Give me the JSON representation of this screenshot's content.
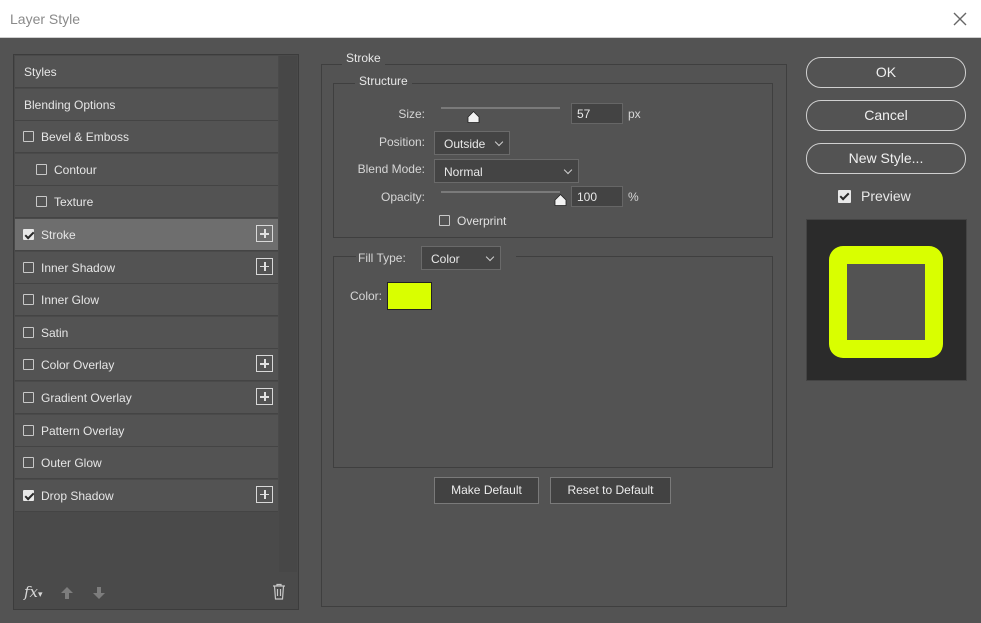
{
  "window": {
    "title": "Layer Style",
    "close_icon": "close-icon"
  },
  "styles_list": {
    "items": [
      {
        "label": "Styles",
        "checkbox": false,
        "checked": false,
        "indent": 0,
        "plus": false,
        "selected": false
      },
      {
        "label": "Blending Options",
        "checkbox": false,
        "checked": false,
        "indent": 0,
        "plus": false,
        "selected": false
      },
      {
        "label": "Bevel & Emboss",
        "checkbox": true,
        "checked": false,
        "indent": 0,
        "plus": false,
        "selected": false
      },
      {
        "label": "Contour",
        "checkbox": true,
        "checked": false,
        "indent": 1,
        "plus": false,
        "selected": false
      },
      {
        "label": "Texture",
        "checkbox": true,
        "checked": false,
        "indent": 1,
        "plus": false,
        "selected": false
      },
      {
        "label": "Stroke",
        "checkbox": true,
        "checked": true,
        "indent": 0,
        "plus": true,
        "selected": true
      },
      {
        "label": "Inner Shadow",
        "checkbox": true,
        "checked": false,
        "indent": 0,
        "plus": true,
        "selected": false
      },
      {
        "label": "Inner Glow",
        "checkbox": true,
        "checked": false,
        "indent": 0,
        "plus": false,
        "selected": false
      },
      {
        "label": "Satin",
        "checkbox": true,
        "checked": false,
        "indent": 0,
        "plus": false,
        "selected": false
      },
      {
        "label": "Color Overlay",
        "checkbox": true,
        "checked": false,
        "indent": 0,
        "plus": true,
        "selected": false
      },
      {
        "label": "Gradient Overlay",
        "checkbox": true,
        "checked": false,
        "indent": 0,
        "plus": true,
        "selected": false
      },
      {
        "label": "Pattern Overlay",
        "checkbox": true,
        "checked": false,
        "indent": 0,
        "plus": false,
        "selected": false
      },
      {
        "label": "Outer Glow",
        "checkbox": true,
        "checked": false,
        "indent": 0,
        "plus": false,
        "selected": false
      },
      {
        "label": "Drop Shadow",
        "checkbox": true,
        "checked": true,
        "indent": 0,
        "plus": true,
        "selected": false
      }
    ],
    "footer": {
      "fx_label": "fx",
      "fx_icon": "fx-icon",
      "move_up_icon": "arrow-up-icon",
      "move_down_icon": "arrow-down-icon",
      "delete_icon": "trash-icon"
    }
  },
  "stroke": {
    "section_title": "Stroke",
    "structure": {
      "title": "Structure",
      "size_label": "Size:",
      "size_value": "57",
      "size_unit": "px",
      "size_slider_fraction": 0.27,
      "position_label": "Position:",
      "position_value": "Outside",
      "blend_mode_label": "Blend Mode:",
      "blend_mode_value": "Normal",
      "opacity_label": "Opacity:",
      "opacity_value": "100",
      "opacity_unit": "%",
      "opacity_slider_fraction": 1.0,
      "overprint_label": "Overprint",
      "overprint_checked": false
    },
    "fill": {
      "fill_type_label": "Fill Type:",
      "fill_type_value": "Color",
      "color_label": "Color:",
      "color_hex": "#d9ff00"
    },
    "make_default_label": "Make Default",
    "reset_default_label": "Reset to Default"
  },
  "actions": {
    "ok_label": "OK",
    "cancel_label": "Cancel",
    "new_style_label": "New Style...",
    "preview_label": "Preview",
    "preview_checked": true
  },
  "colors": {
    "stroke_color": "#d9ff00",
    "panel_bg": "#535353",
    "preview_bg": "#2b2b2b"
  }
}
